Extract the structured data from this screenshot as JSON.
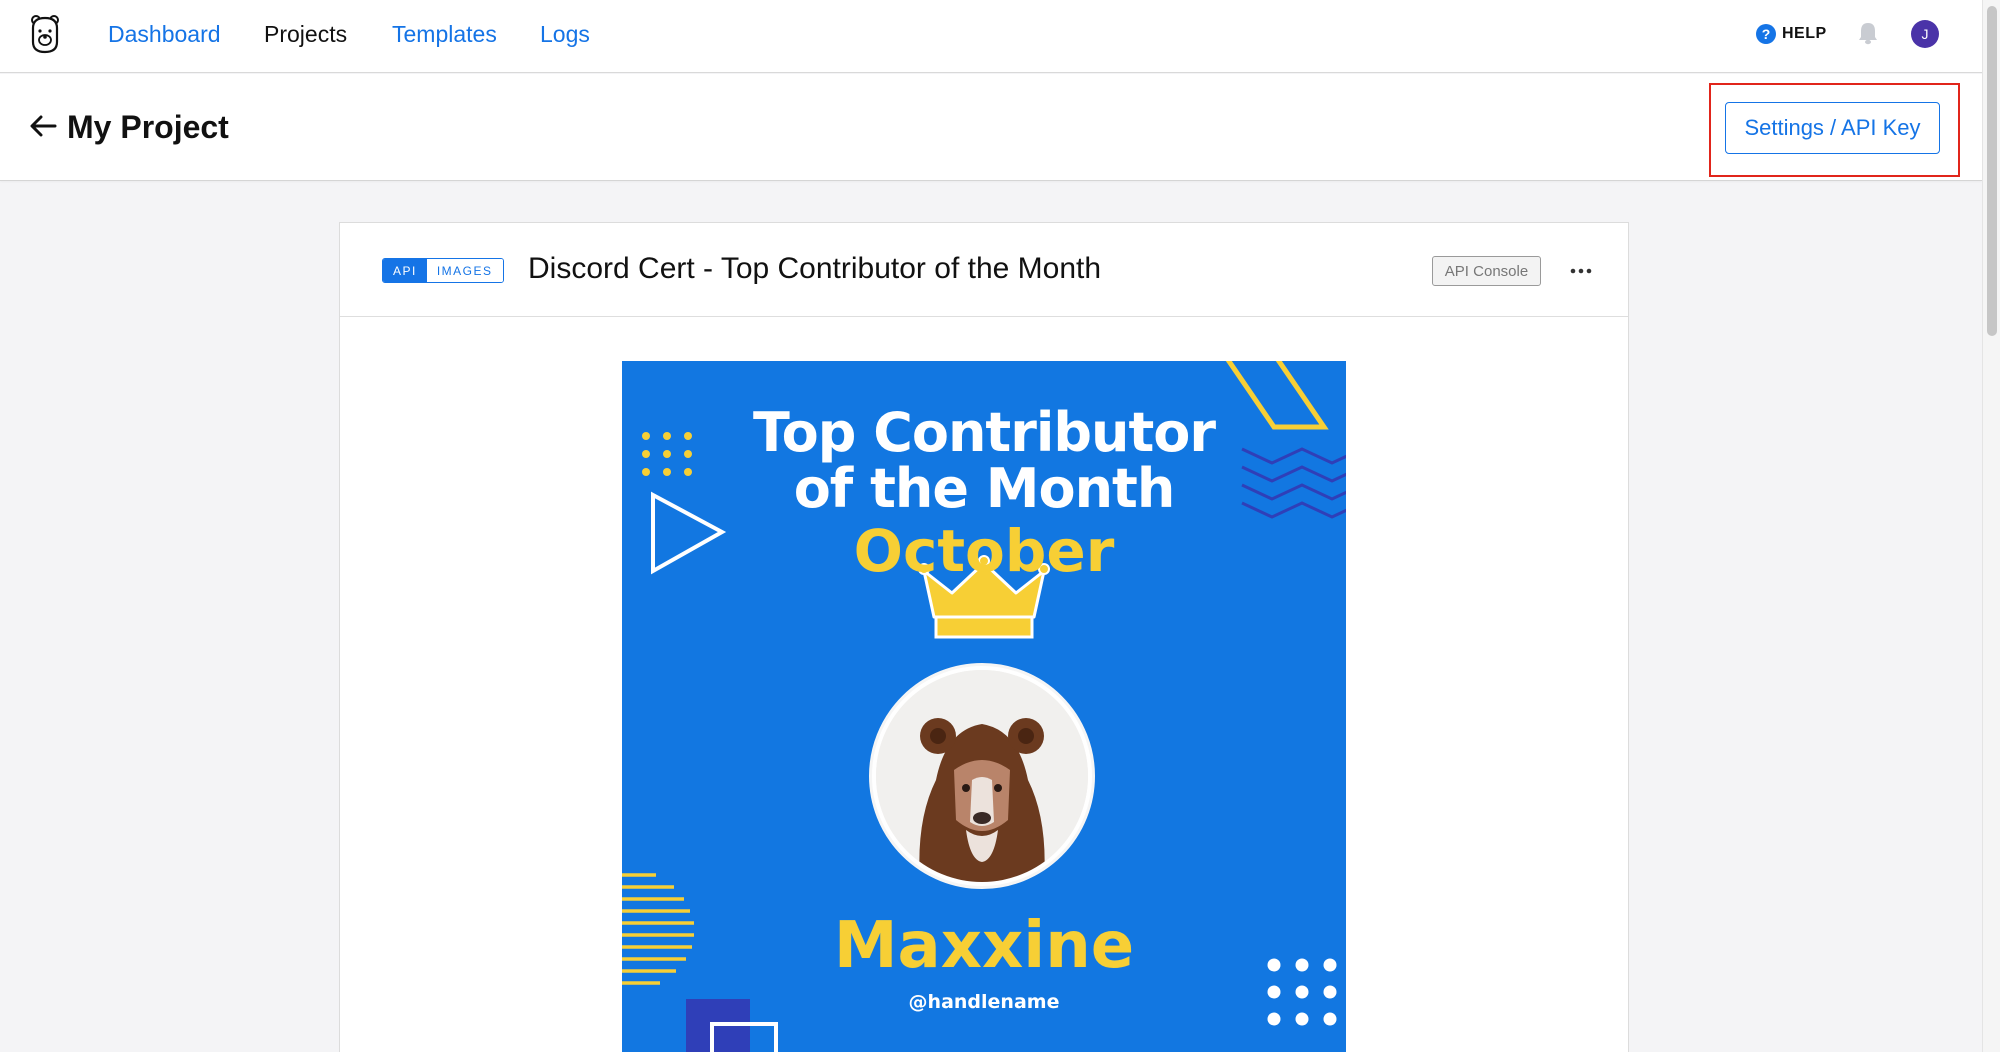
{
  "nav": {
    "items": [
      {
        "label": "Dashboard",
        "active": false
      },
      {
        "label": "Projects",
        "active": true
      },
      {
        "label": "Templates",
        "active": false
      },
      {
        "label": "Logs",
        "active": false
      }
    ],
    "help_label": "HELP",
    "help_icon": "?",
    "avatar_initial": "J"
  },
  "page": {
    "title": "My Project",
    "settings_button": "Settings / API Key"
  },
  "card": {
    "tags": [
      "API",
      "IMAGES"
    ],
    "title": "Discord Cert - Top Contributor of the Month",
    "console_button": "API Console",
    "more_icon": "⋯"
  },
  "certificate": {
    "line1": "Top Contributor",
    "line2": "of the Month",
    "month": "October",
    "name": "Maxxine",
    "handle": "@handlename"
  },
  "colors": {
    "accent": "#1574e6",
    "certificate_bg": "#1277e1",
    "certificate_yellow": "#f7cf35",
    "highlight": "#e1251b"
  }
}
